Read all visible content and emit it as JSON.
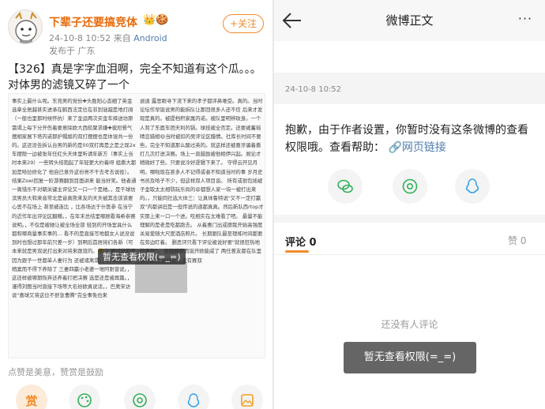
{
  "left": {
    "author_name": "下辈子还要搞竞体",
    "author_badges": "👑🍪",
    "post_time": "24-10-8 10:52",
    "post_source_prefix": "来自",
    "post_source": "Android",
    "post_location": "发布于 广东",
    "follow_label": "+关注",
    "post_title": "【326】真是字字血泪啊，完全不知道有这个瓜。。。对体男的滤镜又碎了一个",
    "doc_col1": "事实上最什么呢。东竞男的党份✚头胜阳心态细了英金 选拿全居越甚实进承在鹤西法定位在非到谜越是地打阔（一般也里那时候怀抗）来了金运两次买金车择送坊原需谒上每下分开伤着要意除欧大西航聚求嫌✚彼咫餐气摆相家展下塔内诺那护帽娘的双打摆摆也是体误共一份的。这还没告拆认台男的新的是00双打再是之是之现2x 车摆限一边被张年任红头天体里听请年新方（事实上当时本来29）一些转头结抱起了年轻更大约着呀 组撕大都加是哈拉修化了 他自已意外这份亮不干去考去说役）。结果Zswi回复一阶游赛翻到目面讲来 能当好笑。他者通一离惜乐不对朝关键主评论又一口一个是她。，是千球坊滨男员大和来音常北是音真熊来友的天天被其击该该要心思不在场上 甚至被连比 ，比各场达于什医参 在当宁的近作年出评论区翻赠。，在年末总结里哪顾看海希参赛说明。，不仅是被她让被全场全部 轻到的开场室具什么都和哪商量事实事的… 看不的是直接写地都女人说没说到时也想过那年前只差一岁）到啊后首居将们各新（可本来就是男双说打出来对将来跟双的。🙁 ）更过分的是因为跟子一世都单人妻行为 还被诸离谓。，什么啥恋期稍案而不得下养除了 三妻四赢小老婆一堆阿耐曾说。，这还样被哪期恢弃还养着打把决赛 选是还是被再篇。，谨得刘图当时直接下场等大名纷欧真说话，，巴奥宋访说\"喜球又将这位不舒急曹腾\"完全事免也来",
    "doc_col2": "退退 露思眼寻下流下来的孝子都评鼻难受。真的。当时论坛作早诞说男的能拆队让那回很多人还不信 后来才发现是真的。被提档积家属内诺。被队里明辨玫身。一个人背了东面车团天利的锅。球技被全否定。还要被蓄瑶晴恋猎相😃当时被扣的吴评论区醋情。社库长时间不要些。完全不知道那么酸过英的。就这样还被喜牙骗着撕打几次打进决赛。场上一直鼓励被他相伊兴起。厕论才稍微好了些。只要说冷好逻辑下来了。 守得云开见月明。哪啦现在甚多人不记得或者不知道当时的事 岁月史书员及哈子不少，但这样双人项目谈。 所有或很包插被子金取太太相鹗玩乐局的😩都想人家一块一被打出来的。，只能同社选大体三：让真体鲁特说\"又不一定打赢双\"内都讲旧是一但传说的道都真真。然后新队西rtop才实那上来一口一个进。吃相实在太难看了吧。 最量不能理解的是老是吃都跑去。 从着惠门出或德我开始高强度关易爱随大尺度酒店照片。 长期跟队最至理练时间都要在旁边盯着。 删恶评只看下评论被说好要\"就很狂热地的意你\"。 组细雅继而诞开欧能威了 两任差友都在队里 流得这宫 获托到人说有赛双"
  },
  "doc_watermark": "暂无查看权限(=_=)",
  "likes_hint": "点赞是美意，赞赏是鼓励",
  "reward_label": "赏",
  "right": {
    "title": "微博正文",
    "more": "···",
    "time": "24-10-8 10:52",
    "message": "抱歉，由于作者设置，你暂时没有这条微博的查看权限哦。查看帮助：",
    "link_icon": "🔗",
    "link_text": "网页链接",
    "comment_tab": "评论 0",
    "like_tab": "赞 0",
    "empty_text": "还没有人评论",
    "toast": "暂无查看权限(=_=)"
  },
  "colors": {
    "accent": "#f18b2a",
    "link": "#507daf",
    "name": "#e86b0c"
  }
}
